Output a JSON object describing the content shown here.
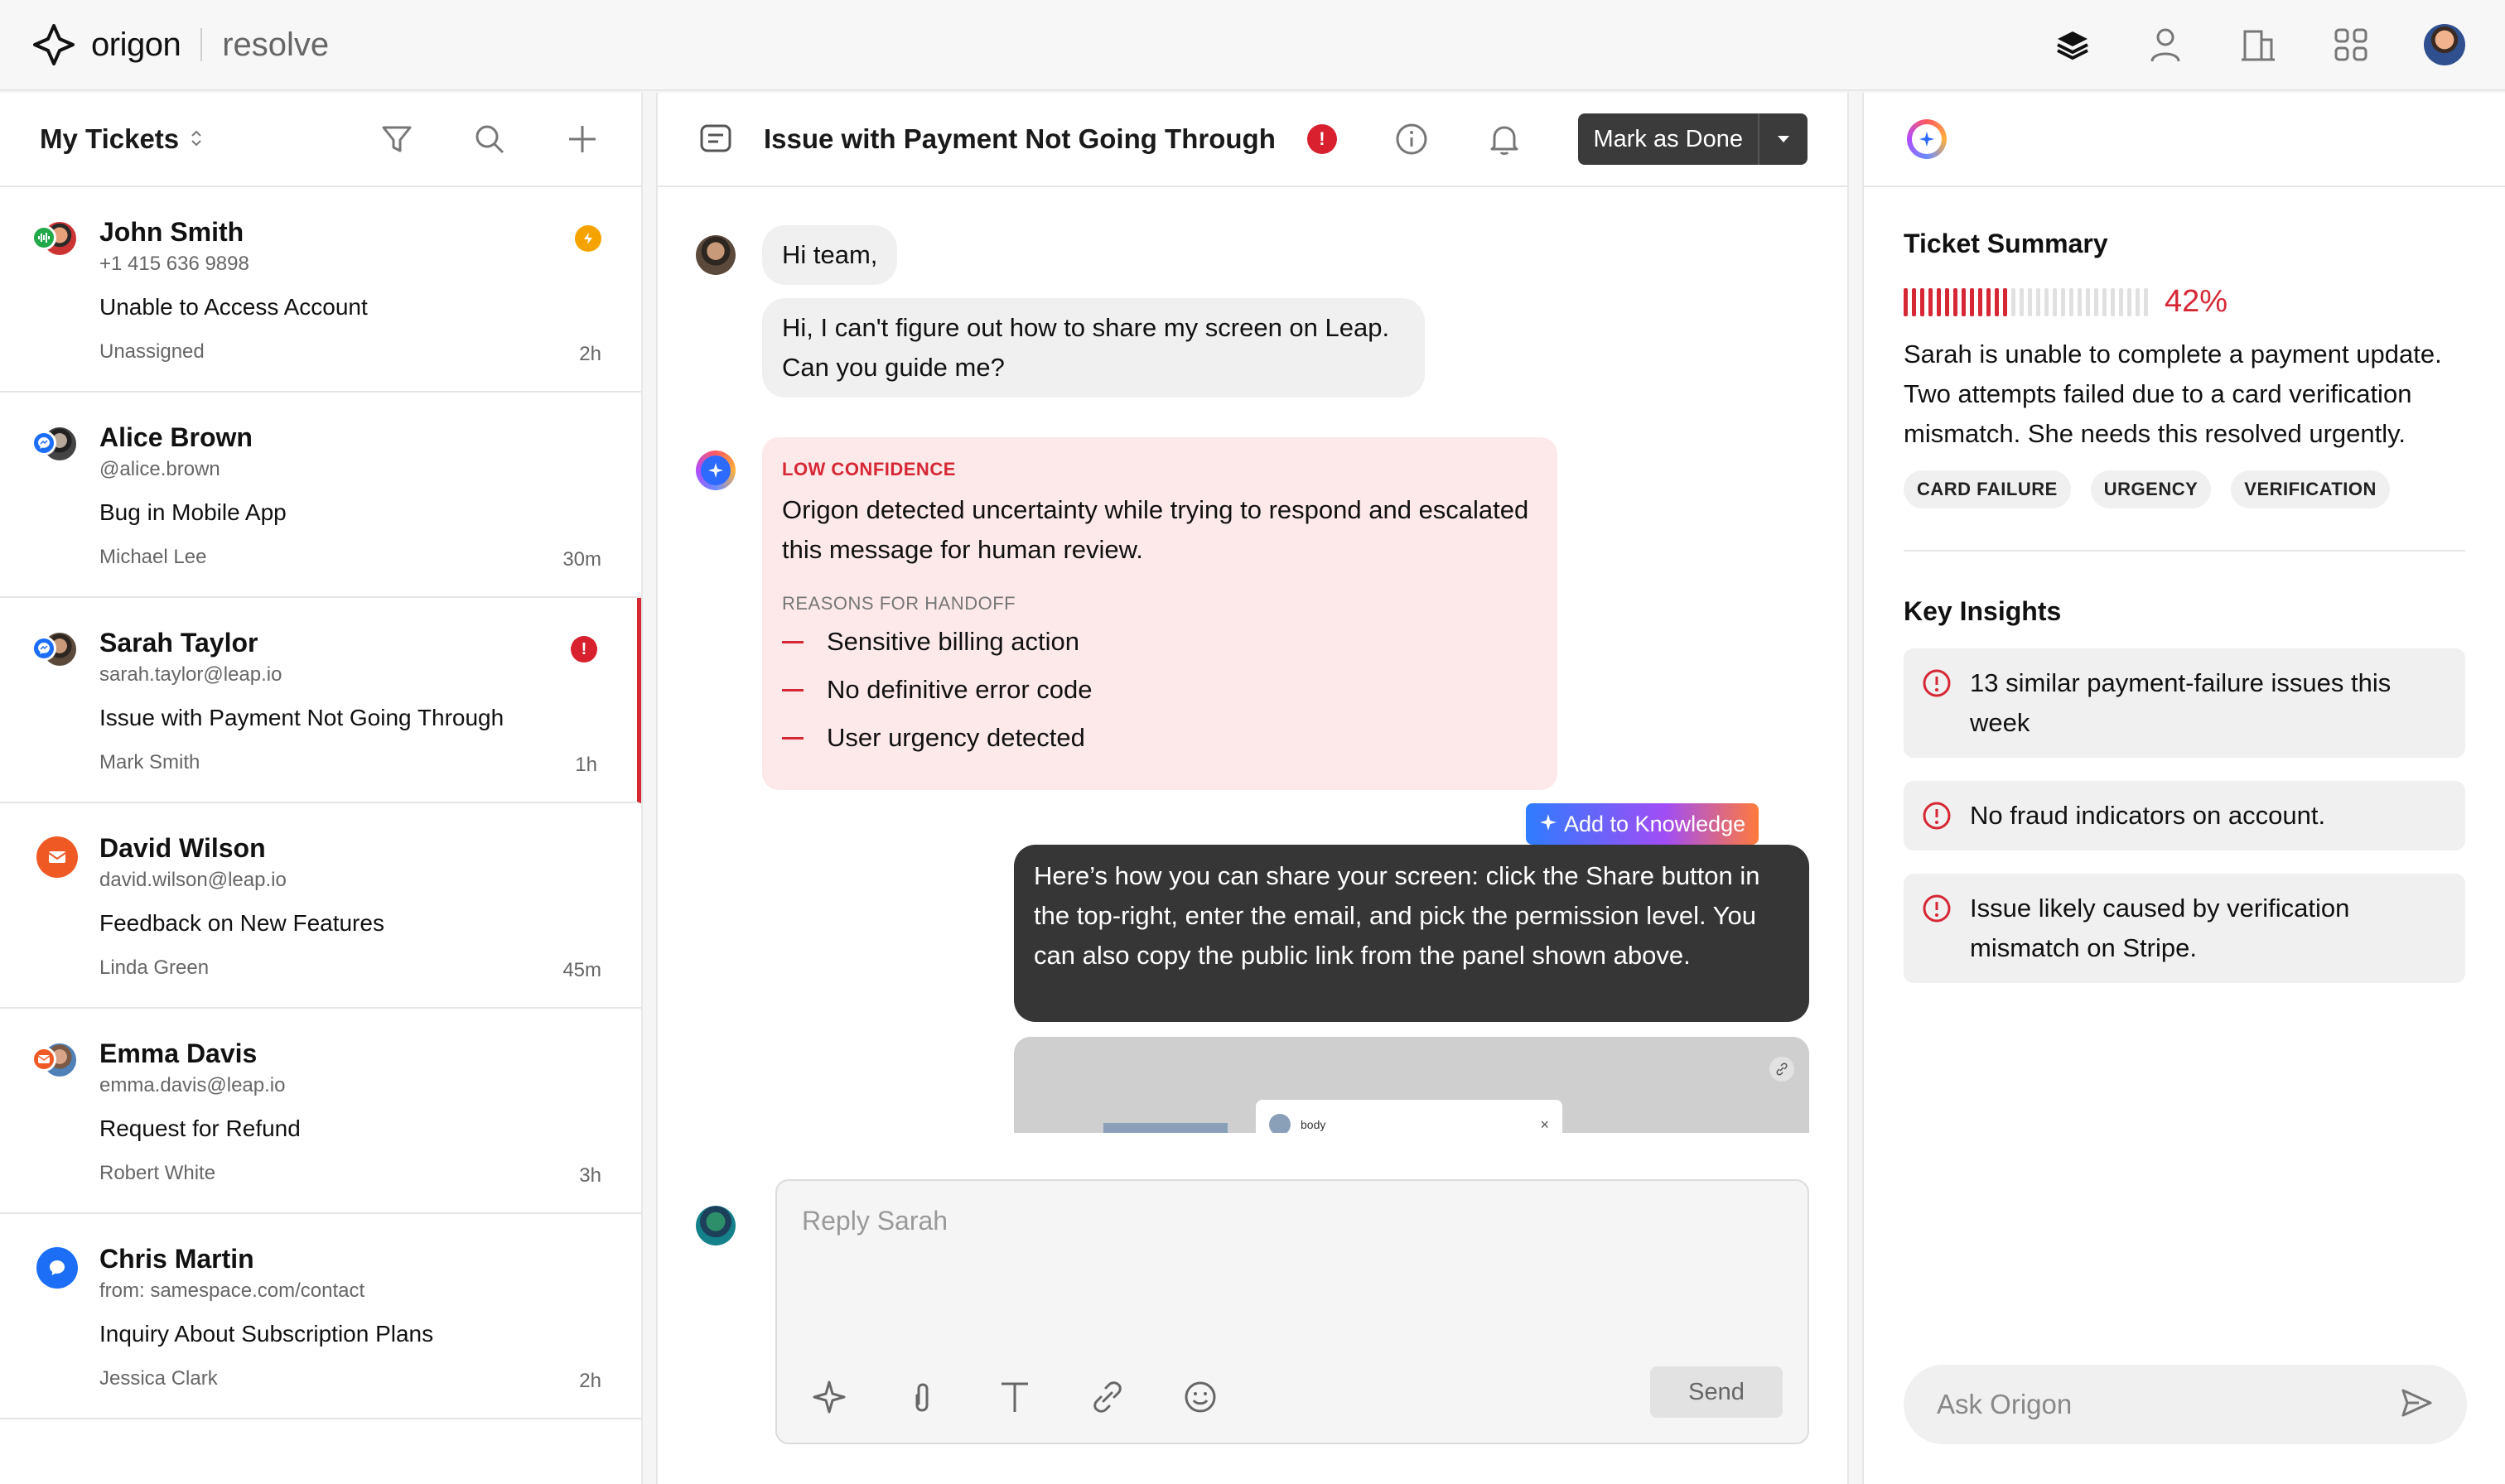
{
  "brand": {
    "name": "origon",
    "product": "resolve"
  },
  "left": {
    "title": "My Tickets",
    "tickets": [
      {
        "name": "John Smith",
        "contact": "+1 415 636 9898",
        "subject": "Unable to Access Account",
        "assignee": "Unassigned",
        "time": "2h",
        "channel": "voice",
        "flag": "bolt"
      },
      {
        "name": "Alice Brown",
        "contact": "@alice.brown",
        "subject": "Bug in Mobile App",
        "assignee": "Michael Lee",
        "time": "30m",
        "channel": "messenger"
      },
      {
        "name": "Sarah Taylor",
        "contact": "sarah.taylor@leap.io",
        "subject": "Issue with Payment Not Going Through",
        "assignee": "Mark Smith",
        "time": "1h",
        "channel": "messenger",
        "flag": "alert"
      },
      {
        "name": "David Wilson",
        "contact": "david.wilson@leap.io",
        "subject": "Feedback on New Features",
        "assignee": "Linda Green",
        "time": "45m",
        "channel": "email"
      },
      {
        "name": "Emma Davis",
        "contact": "emma.davis@leap.io",
        "subject": "Request for Refund",
        "assignee": "Robert White",
        "time": "3h",
        "channel": "email"
      },
      {
        "name": "Chris Martin",
        "contact": "from: samespace.com/contact",
        "subject": "Inquiry About Subscription Plans",
        "assignee": "Jessica Clark",
        "time": "2h",
        "channel": "chat"
      }
    ]
  },
  "center": {
    "title": "Issue with Payment Not Going Through",
    "alert_glyph": "!",
    "done_label": "Mark as Done",
    "messages": {
      "greeting": "Hi team,",
      "question": "Hi, I can't figure out how to share my screen on Leap. Can you guide me?",
      "low_label": "LOW CONFIDENCE",
      "low_text": "Origon detected uncertainty while trying to respond and escalated this message for human review.",
      "reasons_label": "REASONS FOR HANDOFF",
      "reasons": [
        "Sensitive billing action",
        "No definitive error code",
        "User urgency detected"
      ],
      "add_knowledge": "Add to Knowledge",
      "reply": "Here’s how you can share your screen: click the Share button in the top-right, enter the email, and pick the permission level. You can also copy the public link from the panel shown above.",
      "preview_card": "body"
    },
    "reply_placeholder": "Reply Sarah",
    "send_label": "Send"
  },
  "right": {
    "summary_title": "Ticket Summary",
    "progress_label": "42%",
    "progress_value": 0.42,
    "summary": "Sarah is unable to complete a payment update. Two attempts failed due to a card verification mismatch. She needs this resolved urgently.",
    "tags": [
      "CARD FAILURE",
      "URGENCY",
      "VERIFICATION"
    ],
    "insights_title": "Key Insights",
    "insights": [
      "13 similar payment-failure issues this week",
      "No fraud indicators on account.",
      "Issue likely caused by verification mismatch on Stripe."
    ],
    "ask_placeholder": "Ask Origon"
  },
  "colors": {
    "accent": "#d62735",
    "dark": "#363636",
    "bubble": "#f0f0f0"
  }
}
